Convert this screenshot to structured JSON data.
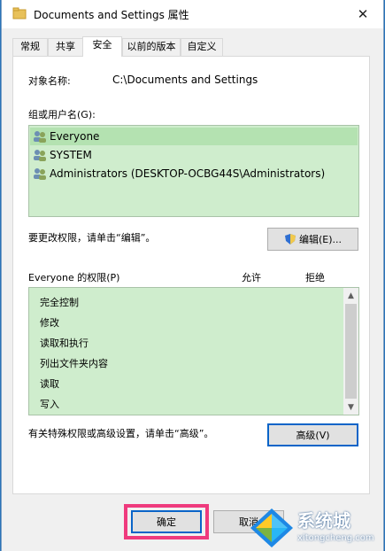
{
  "window": {
    "title": "Documents and Settings 属性"
  },
  "tabs": [
    {
      "label": "常规"
    },
    {
      "label": "共享"
    },
    {
      "label": "安全"
    },
    {
      "label": "以前的版本"
    },
    {
      "label": "自定义"
    }
  ],
  "object": {
    "label": "对象名称:",
    "value": "C:\\Documents and Settings"
  },
  "groups": {
    "label": "组或用户名(G):",
    "items": [
      {
        "name": "Everyone"
      },
      {
        "name": "SYSTEM"
      },
      {
        "name": "Administrators (DESKTOP-OCBG44S\\Administrators)"
      }
    ]
  },
  "edit_hint": "要更改权限，请单击“编辑”。",
  "edit_button": "编辑(E)...",
  "permissions": {
    "label": "Everyone 的权限(P)",
    "allow": "允许",
    "deny": "拒绝",
    "items": [
      {
        "name": "完全控制"
      },
      {
        "name": "修改"
      },
      {
        "name": "读取和执行"
      },
      {
        "name": "列出文件夹内容"
      },
      {
        "name": "读取"
      },
      {
        "name": "写入"
      }
    ]
  },
  "advanced_hint": "有关特殊权限或高级设置，请单击“高级”。",
  "advanced_button": "高级(V)",
  "footer": {
    "ok": "确定",
    "cancel": "取消"
  },
  "watermark": {
    "brand": "系统城",
    "url": "xitongcheng.com"
  },
  "colors": {
    "list_bg": "#cfedcd",
    "highlight": "#ef3a7d",
    "accent": "#0a64c8"
  }
}
